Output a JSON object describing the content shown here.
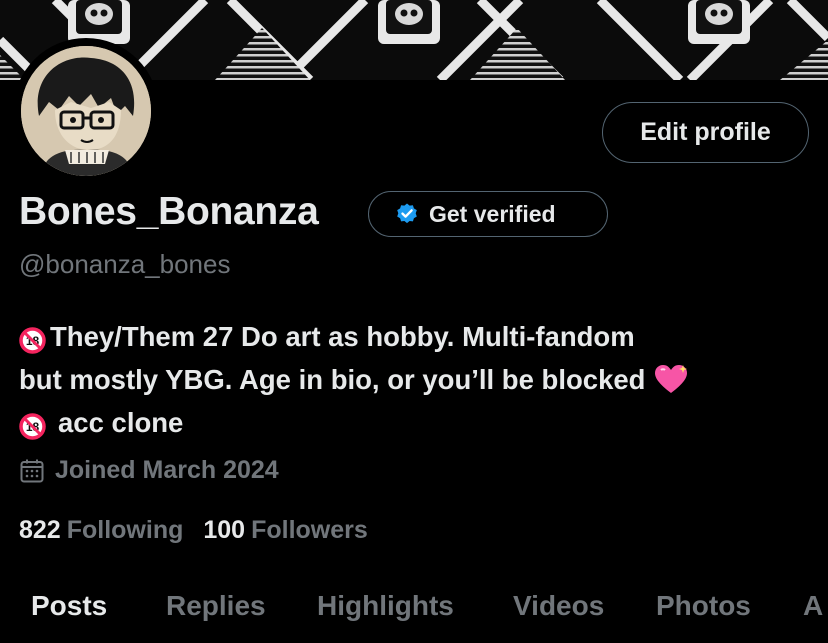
{
  "profile": {
    "display_name": "Bones_Bonanza",
    "handle": "@bonanza_bones",
    "edit_label": "Edit profile",
    "verify_label": "Get verified",
    "bio": {
      "line1": "They/Them 27 Do art as hobby. Multi-fandom",
      "line2": "but mostly YBG. Age in bio, or you’ll be blocked",
      "line3": "acc clone"
    },
    "joined": "Joined March 2024",
    "following_count": "822",
    "following_label": "Following",
    "followers_count": "100",
    "followers_label": "Followers"
  },
  "icons": {
    "verified": "verified-badge-icon",
    "calendar": "calendar-icon",
    "age_restricted": "no-under-18-emoji",
    "heart": "sparkling-heart-emoji"
  },
  "tabs": [
    {
      "label": "Posts",
      "active": true
    },
    {
      "label": "Replies",
      "active": false
    },
    {
      "label": "Highlights",
      "active": false
    },
    {
      "label": "Videos",
      "active": false
    },
    {
      "label": "Photos",
      "active": false
    },
    {
      "label": "A",
      "active": false
    }
  ],
  "colors": {
    "background": "#000000",
    "text_primary": "#e7e9ea",
    "text_secondary": "#71767b",
    "border": "#536471",
    "verified_blue": "#1d9bf0",
    "emoji_red": "#f4245e",
    "heart_pink": "#f755a6"
  }
}
